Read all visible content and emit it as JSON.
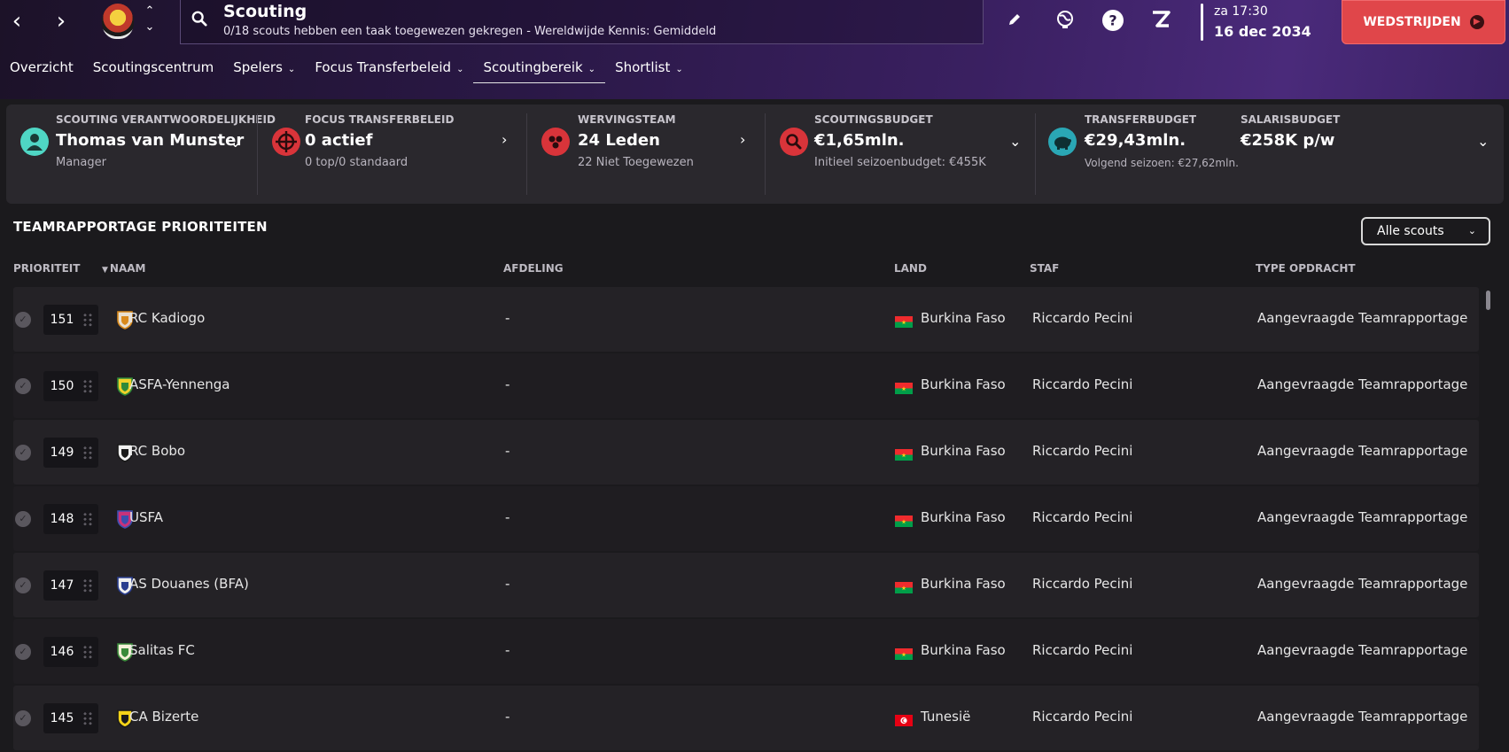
{
  "header": {
    "title": "Scouting",
    "subtitle": "0/18 scouts hebben een taak toegewezen gekregen - Wereldwijde Kennis: Gemiddeld",
    "clock_day": "za 17:30",
    "clock_date": "16 dec 2034",
    "continue_label": "WEDSTRIJDEN"
  },
  "tabs": [
    {
      "label": "Overzicht",
      "dropdown": false,
      "active": false
    },
    {
      "label": "Scoutingscentrum",
      "dropdown": false,
      "active": false
    },
    {
      "label": "Spelers",
      "dropdown": true,
      "active": false
    },
    {
      "label": "Focus Transferbeleid",
      "dropdown": true,
      "active": false
    },
    {
      "label": "Scoutingbereik",
      "dropdown": true,
      "active": true
    },
    {
      "label": "Shortlist",
      "dropdown": true,
      "active": false
    }
  ],
  "stats": {
    "responsibility": {
      "label": "SCOUTING VERANTWOORDELIJKHEID",
      "value": "Thomas van Munster",
      "sub": "Manager"
    },
    "focus": {
      "label": "FOCUS TRANSFERBELEID",
      "value": "0 actief",
      "sub": "0 top/0 standaard"
    },
    "recruitment": {
      "label": "WERVINGSTEAM",
      "value": "24 Leden",
      "sub": "22 Niet Toegewezen"
    },
    "scouting_budget": {
      "label": "SCOUTINGSBUDGET",
      "value": "€1,65mln.",
      "sub": "Initieel seizoenbudget: €455K"
    },
    "transfer_budget": {
      "label": "TRANSFERBUDGET",
      "value": "€29,43mln.",
      "sub": "Volgend seizoen: €27,62mln."
    },
    "wage_budget": {
      "label": "SALARISBUDGET",
      "value": "€258K p/w"
    }
  },
  "section": {
    "title": "TEAMRAPPORTAGE PRIORITEITEN",
    "filter_label": "Alle scouts"
  },
  "columns": {
    "priority": "PRIORITEIT",
    "name": "NAAM",
    "department": "AFDELING",
    "country": "LAND",
    "staff": "STAF",
    "assignment": "TYPE OPDRACHT"
  },
  "rows": [
    {
      "priority": "151",
      "name": "RC Kadiogo",
      "department": "-",
      "country": "Burkina Faso",
      "staff": "Riccardo Pecini",
      "assignment": "Aangevraagde Teamrapportage",
      "crest_colors": [
        "#e8e0d0",
        "#d98a1c"
      ]
    },
    {
      "priority": "150",
      "name": "ASFA-Yennenga",
      "department": "-",
      "country": "Burkina Faso",
      "staff": "Riccardo Pecini",
      "assignment": "Aangevraagde Teamrapportage",
      "crest_colors": [
        "#f1d12a",
        "#2f8a3a"
      ]
    },
    {
      "priority": "149",
      "name": "RC Bobo",
      "department": "-",
      "country": "Burkina Faso",
      "staff": "Riccardo Pecini",
      "assignment": "Aangevraagde Teamrapportage",
      "crest_colors": [
        "#f2f2f2",
        "#1a1a1a"
      ]
    },
    {
      "priority": "148",
      "name": "USFA",
      "department": "-",
      "country": "Burkina Faso",
      "staff": "Riccardo Pecini",
      "assignment": "Aangevraagde Teamrapportage",
      "crest_colors": [
        "#c8327a",
        "#3b4fb0"
      ]
    },
    {
      "priority": "147",
      "name": "AS Douanes (BFA)",
      "department": "-",
      "country": "Burkina Faso",
      "staff": "Riccardo Pecini",
      "assignment": "Aangevraagde Teamrapportage",
      "crest_colors": [
        "#f0f0f0",
        "#2a3e8f"
      ]
    },
    {
      "priority": "146",
      "name": "Salitas FC",
      "department": "-",
      "country": "Burkina Faso",
      "staff": "Riccardo Pecini",
      "assignment": "Aangevraagde Teamrapportage",
      "crest_colors": [
        "#f4f0d8",
        "#3a8a3a"
      ]
    },
    {
      "priority": "145",
      "name": "CA Bizerte",
      "department": "-",
      "country": "Tunesië",
      "staff": "Riccardo Pecini",
      "assignment": "Aangevraagde Teamrapportage",
      "crest_colors": [
        "#f4d318",
        "#1a1a1a"
      ]
    }
  ],
  "colors": {
    "accent_red": "#e0464a",
    "icon_teal": "#4fd6c4",
    "icon_red": "#d9343a",
    "icon_cyan": "#2aa7b5"
  }
}
